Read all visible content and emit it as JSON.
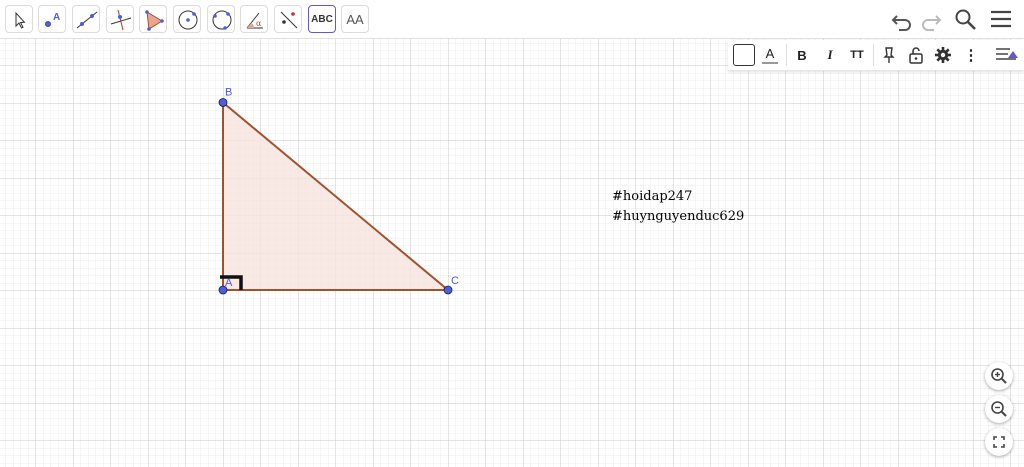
{
  "toolbar": {
    "tools": [
      {
        "name": "move-tool",
        "active": false
      },
      {
        "name": "point-tool",
        "active": false,
        "label": "A"
      },
      {
        "name": "line-tool",
        "active": false
      },
      {
        "name": "perpendicular-line-tool",
        "active": false
      },
      {
        "name": "polygon-tool",
        "active": false
      },
      {
        "name": "circle-center-point-tool",
        "active": false
      },
      {
        "name": "circle-three-points-tool",
        "active": false
      },
      {
        "name": "angle-tool",
        "active": false,
        "label": "α"
      },
      {
        "name": "reflect-tool",
        "active": false
      },
      {
        "name": "text-tool",
        "active": true,
        "label": "ABC"
      },
      {
        "name": "slider-tool",
        "active": false,
        "label": "AA"
      }
    ],
    "right_icons": [
      "undo-icon",
      "redo-icon",
      "search-icon",
      "menu-icon"
    ]
  },
  "style_bar": {
    "buttons": [
      {
        "name": "background-color-button",
        "label": ""
      },
      {
        "name": "text-color-button",
        "label": "A"
      },
      {
        "name": "bold-button",
        "label": "B"
      },
      {
        "name": "italic-button",
        "label": "I"
      },
      {
        "name": "text-size-button",
        "label": "TT"
      },
      {
        "name": "pin-button",
        "label": ""
      },
      {
        "name": "lock-button",
        "label": ""
      },
      {
        "name": "settings-button",
        "label": ""
      },
      {
        "name": "more-button",
        "label": "⋮"
      },
      {
        "name": "toggle-style-bar-button",
        "label": ""
      }
    ]
  },
  "canvas": {
    "points": [
      {
        "label": "A",
        "x": 0,
        "y": 0
      },
      {
        "label": "B",
        "x": 0,
        "y": 5
      },
      {
        "label": "C",
        "x": 6,
        "y": 0
      }
    ],
    "polygon_fill": "#f6e4de",
    "polygon_stroke": "#a0522d",
    "point_color": "#4d5de0",
    "right_angle_at": "A"
  },
  "note": {
    "line1": "#hoidap247",
    "line2": "#huynguyenduc629"
  },
  "zoom_controls": [
    "zoom-in-icon",
    "zoom-out-icon",
    "fullscreen-icon"
  ],
  "colors": {
    "accent": "#6557d2",
    "grid_major": "#c8c8c8",
    "grid_minor": "#ececec"
  }
}
